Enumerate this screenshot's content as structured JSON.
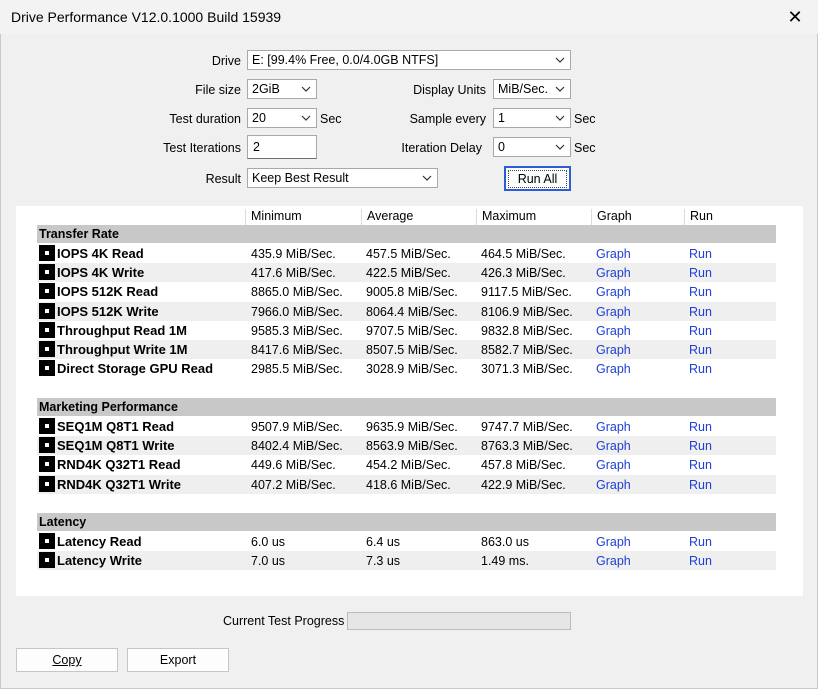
{
  "window": {
    "title": "Drive Performance V12.0.1000 Build 15939"
  },
  "settings": {
    "drive_label": "Drive",
    "drive_value": "E: [99.4% Free, 0.0/4.0GB NTFS]",
    "file_size_label": "File size",
    "file_size_value": "2GiB",
    "display_units_label": "Display Units",
    "display_units_value": "MiB/Sec.",
    "test_duration_label": "Test duration",
    "test_duration_value": "20",
    "test_duration_unit": "Sec",
    "sample_every_label": "Sample every",
    "sample_every_value": "1",
    "sample_every_unit": "Sec",
    "test_iterations_label": "Test Iterations",
    "test_iterations_value": "2",
    "iteration_delay_label": "Iteration Delay",
    "iteration_delay_value": "0",
    "iteration_delay_unit": "Sec",
    "result_label": "Result",
    "result_value": "Keep Best Result",
    "run_all_label": "Run All"
  },
  "columns": [
    "Minimum",
    "Average",
    "Maximum",
    "Graph",
    "Run"
  ],
  "sections": [
    {
      "title": "Transfer Rate",
      "rows": [
        {
          "name": "IOPS 4K Read",
          "min": "435.9 MiB/Sec.",
          "avg": "457.5 MiB/Sec.",
          "max": "464.5 MiB/Sec.",
          "graph": "Graph",
          "run": "Run"
        },
        {
          "name": "IOPS 4K Write",
          "min": "417.6 MiB/Sec.",
          "avg": "422.5 MiB/Sec.",
          "max": "426.3 MiB/Sec.",
          "graph": "Graph",
          "run": "Run"
        },
        {
          "name": "IOPS 512K Read",
          "min": "8865.0 MiB/Sec.",
          "avg": "9005.8 MiB/Sec.",
          "max": "9117.5 MiB/Sec.",
          "graph": "Graph",
          "run": "Run"
        },
        {
          "name": "IOPS 512K Write",
          "min": "7966.0 MiB/Sec.",
          "avg": "8064.4 MiB/Sec.",
          "max": "8106.9 MiB/Sec.",
          "graph": "Graph",
          "run": "Run"
        },
        {
          "name": "Throughput Read 1M",
          "min": "9585.3 MiB/Sec.",
          "avg": "9707.5 MiB/Sec.",
          "max": "9832.8 MiB/Sec.",
          "graph": "Graph",
          "run": "Run"
        },
        {
          "name": "Throughput Write 1M",
          "min": "8417.6 MiB/Sec.",
          "avg": "8507.5 MiB/Sec.",
          "max": "8582.7 MiB/Sec.",
          "graph": "Graph",
          "run": "Run"
        },
        {
          "name": "Direct Storage GPU Read",
          "min": "2985.5 MiB/Sec.",
          "avg": "3028.9 MiB/Sec.",
          "max": "3071.3 MiB/Sec.",
          "graph": "Graph",
          "run": "Run"
        }
      ]
    },
    {
      "title": "Marketing Performance",
      "rows": [
        {
          "name": "SEQ1M Q8T1 Read",
          "min": "9507.9 MiB/Sec.",
          "avg": "9635.9 MiB/Sec.",
          "max": "9747.7 MiB/Sec.",
          "graph": "Graph",
          "run": "Run"
        },
        {
          "name": "SEQ1M Q8T1 Write",
          "min": "8402.4 MiB/Sec.",
          "avg": "8563.9 MiB/Sec.",
          "max": "8763.3 MiB/Sec.",
          "graph": "Graph",
          "run": "Run"
        },
        {
          "name": "RND4K Q32T1 Read",
          "min": "449.6 MiB/Sec.",
          "avg": "454.2 MiB/Sec.",
          "max": "457.8 MiB/Sec.",
          "graph": "Graph",
          "run": "Run"
        },
        {
          "name": "RND4K Q32T1 Write",
          "min": "407.2 MiB/Sec.",
          "avg": "418.6 MiB/Sec.",
          "max": "422.9 MiB/Sec.",
          "graph": "Graph",
          "run": "Run"
        }
      ]
    },
    {
      "title": "Latency",
      "rows": [
        {
          "name": "Latency Read",
          "min": "6.0 us",
          "avg": "6.4 us",
          "max": "863.0 us",
          "graph": "Graph",
          "run": "Run"
        },
        {
          "name": "Latency Write",
          "min": "7.0 us",
          "avg": "7.3 us",
          "max": "1.49 ms.",
          "graph": "Graph",
          "run": "Run"
        }
      ]
    }
  ],
  "footer": {
    "progress_label": "Current Test Progress",
    "copy_label": "Copy",
    "export_label": "Export"
  }
}
